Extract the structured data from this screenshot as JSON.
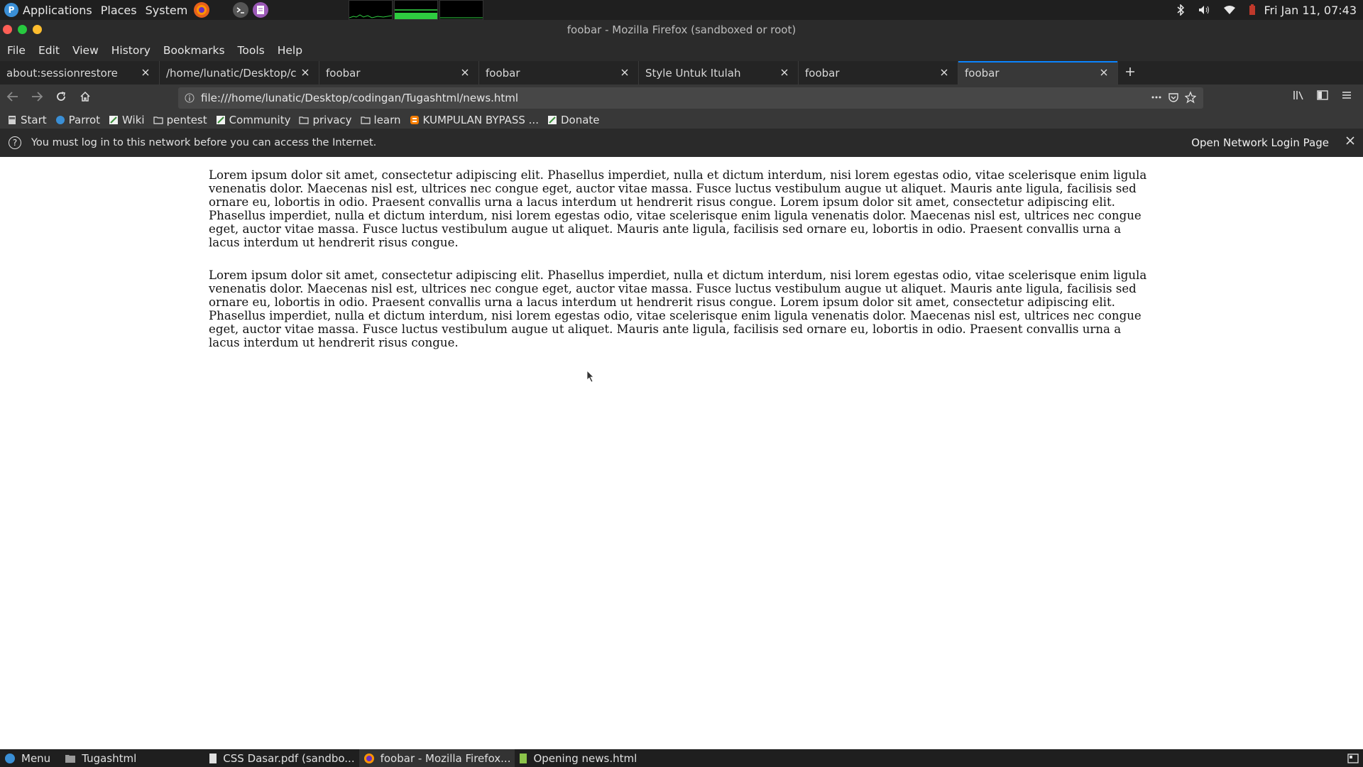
{
  "top_panel": {
    "menus": [
      "Applications",
      "Places",
      "System"
    ],
    "clock": "Fri Jan 11, 07:43"
  },
  "window": {
    "title": "foobar - Mozilla Firefox (sandboxed or root)"
  },
  "menubar": [
    "File",
    "Edit",
    "View",
    "History",
    "Bookmarks",
    "Tools",
    "Help"
  ],
  "tabs": [
    {
      "label": "about:sessionrestore",
      "active": false
    },
    {
      "label": "/home/lunatic/Desktop/codi",
      "active": false
    },
    {
      "label": "foobar",
      "active": false
    },
    {
      "label": "foobar",
      "active": false
    },
    {
      "label": "Style Untuk Itulah",
      "active": false
    },
    {
      "label": "foobar",
      "active": false
    },
    {
      "label": "foobar",
      "active": true
    }
  ],
  "urlbar": {
    "url": "file:///home/lunatic/Desktop/codingan/Tugashtml/news.html"
  },
  "bookmarks": [
    {
      "label": "Start",
      "icon": "page-icon"
    },
    {
      "label": "Parrot",
      "icon": "parrot-icon"
    },
    {
      "label": "Wiki",
      "icon": "wiki-icon"
    },
    {
      "label": "pentest",
      "icon": "folder-icon"
    },
    {
      "label": "Community",
      "icon": "wiki-icon"
    },
    {
      "label": "privacy",
      "icon": "folder-icon"
    },
    {
      "label": "learn",
      "icon": "folder-icon"
    },
    {
      "label": "KUMPULAN BYPASS ...",
      "icon": "blogger-icon"
    },
    {
      "label": "Donate",
      "icon": "wiki-icon"
    }
  ],
  "notification": {
    "message": "You must log in to this network before you can access the Internet.",
    "button": "Open Network Login Page"
  },
  "content": {
    "paragraphs": [
      "Lorem ipsum dolor sit amet, consectetur adipiscing elit. Phasellus imperdiet, nulla et dictum interdum, nisi lorem egestas odio, vitae scelerisque enim ligula venenatis dolor. Maecenas nisl est, ultrices nec congue eget, auctor vitae massa. Fusce luctus vestibulum augue ut aliquet. Mauris ante ligula, facilisis sed ornare eu, lobortis in odio. Praesent convallis urna a lacus interdum ut hendrerit risus congue. Lorem ipsum dolor sit amet, consectetur adipiscing elit. Phasellus imperdiet, nulla et dictum interdum, nisi lorem egestas odio, vitae scelerisque enim ligula venenatis dolor. Maecenas nisl est, ultrices nec congue eget, auctor vitae massa. Fusce luctus vestibulum augue ut aliquet. Mauris ante ligula, facilisis sed ornare eu, lobortis in odio. Praesent convallis urna a lacus interdum ut hendrerit risus congue.",
      "Lorem ipsum dolor sit amet, consectetur adipiscing elit. Phasellus imperdiet, nulla et dictum interdum, nisi lorem egestas odio, vitae scelerisque enim ligula venenatis dolor. Maecenas nisl est, ultrices nec congue eget, auctor vitae massa. Fusce luctus vestibulum augue ut aliquet. Mauris ante ligula, facilisis sed ornare eu, lobortis in odio. Praesent convallis urna a lacus interdum ut hendrerit risus congue. Lorem ipsum dolor sit amet, consectetur adipiscing elit. Phasellus imperdiet, nulla et dictum interdum, nisi lorem egestas odio, vitae scelerisque enim ligula venenatis dolor. Maecenas nisl est, ultrices nec congue eget, auctor vitae massa. Fusce luctus vestibulum augue ut aliquet. Mauris ante ligula, facilisis sed ornare eu, lobortis in odio. Praesent convallis urna a lacus interdum ut hendrerit risus congue."
    ]
  },
  "taskbar": [
    {
      "label": "Menu",
      "icon": "parrot-icon",
      "active": false
    },
    {
      "label": "Tugashtml",
      "icon": "folder-icon",
      "active": false
    },
    {
      "label": "CSS Dasar.pdf (sandbo...",
      "icon": "document-icon",
      "active": false
    },
    {
      "label": "foobar - Mozilla Firefox...",
      "icon": "firefox-icon",
      "active": true
    },
    {
      "label": "Opening news.html",
      "icon": "dialog-icon",
      "active": false
    }
  ],
  "colors": {
    "accent": "#0a84ff",
    "panel_bg": "#1f1f1f",
    "toolbar_bg": "#383838",
    "close_red": "#ff5f56",
    "min_green": "#27c93f",
    "max_yellow": "#ffbd2e"
  }
}
